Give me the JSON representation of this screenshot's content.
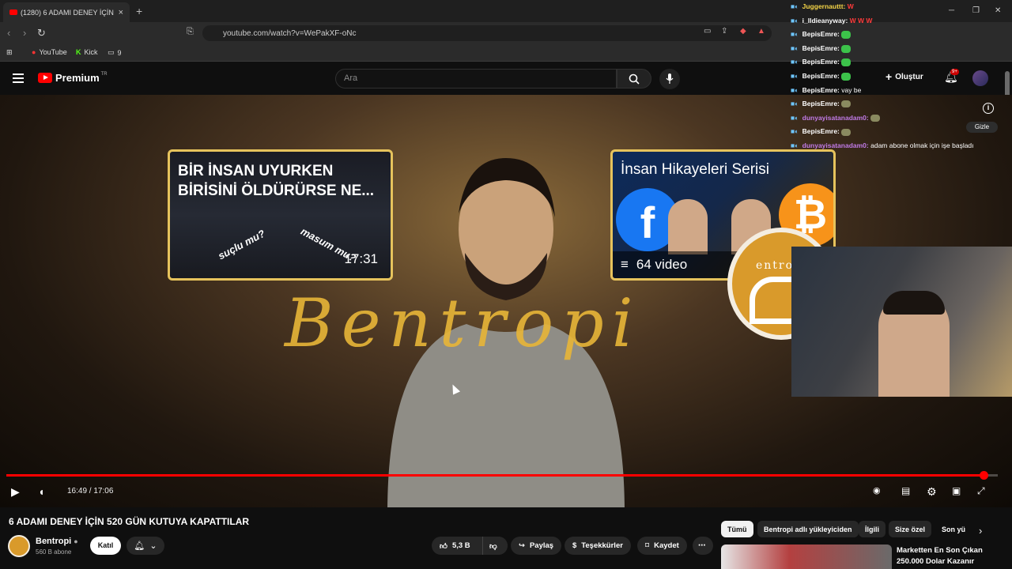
{
  "browser": {
    "tab_title": "(1280) 6 ADAMI DENEY İÇİN",
    "url": "youtube.com/watch?v=WePakXF-oNc",
    "bookmarks": [
      "YouTube",
      "Kick",
      "9"
    ]
  },
  "youtube": {
    "logo": "Premium",
    "logo_region": "TR",
    "search_placeholder": "Ara",
    "create_label": "Oluştur",
    "notif_count": "9+"
  },
  "video": {
    "card1_title": "BİR İNSAN UYURKEN BİRİSİNİ ÖLDÜRÜRSE NE...",
    "card1_sticker1": "suçlu mu?",
    "card1_sticker2": "masum mu?",
    "card1_duration": "17:31",
    "card2_title": "İnsan Hikayeleri Serisi",
    "card2_count": "64 video",
    "signature": "Bentropi",
    "brand_text": "entro",
    "time_current": "16:49",
    "time_sep": " / ",
    "time_total": "17:06",
    "progress_fraction": 0.986,
    "hide_label": "Gizle"
  },
  "chat": [
    {
      "user": "Juggernauttt:",
      "msg": "W",
      "color": "#f5d547",
      "msgcolor": "#ff3b3b"
    },
    {
      "user": "i_lldieanyway:",
      "msg": "W W W",
      "color": "#ffffff",
      "msgcolor": "#ff3b3b"
    },
    {
      "user": "BepisEmre:",
      "msg": "",
      "color": "#ffffff",
      "emote": "green"
    },
    {
      "user": "BepisEmre:",
      "msg": "",
      "color": "#ffffff",
      "emote": "green"
    },
    {
      "user": "BepisEmre:",
      "msg": "",
      "color": "#ffffff",
      "emote": "green"
    },
    {
      "user": "BepisEmre:",
      "msg": "",
      "color": "#ffffff",
      "emote": "green"
    },
    {
      "user": "BepisEmre:",
      "msg": "vay be",
      "color": "#ffffff",
      "msgcolor": "#ffffff"
    },
    {
      "user": "BepisEmre:",
      "msg": "",
      "color": "#ffffff",
      "emote": "gray"
    },
    {
      "user": "dunyayisatanadam0:",
      "msg": "",
      "color": "#c07ae6",
      "emote": "gray"
    },
    {
      "user": "BepisEmre:",
      "msg": "",
      "color": "#ffffff",
      "emote": "gray"
    },
    {
      "user": "dunyayisatanadam0:",
      "msg": "adam abone olmak için işe başladı",
      "color": "#c07ae6",
      "msgcolor": "#ffffff"
    }
  ],
  "below": {
    "title": "6 ADAMI DENEY İÇİN 520 GÜN KUTUYA KAPATTILAR",
    "channel": "Bentropi",
    "subs": "560 B abone",
    "join": "Katıl",
    "likes": "5,3 B",
    "share": "Paylaş",
    "thanks": "Teşekkürler",
    "save": "Kaydet",
    "chips": [
      "Tümü",
      "Bentropi adlı yükleyiciden",
      "İlgili",
      "Size özel",
      "Son yü"
    ],
    "rec_title": "Marketten En Son Çıkan 250.000 Dolar Kazanır"
  },
  "colors": {
    "accent": "#ff0000",
    "card_border": "#e6c35c",
    "signature": "#e8b638"
  }
}
